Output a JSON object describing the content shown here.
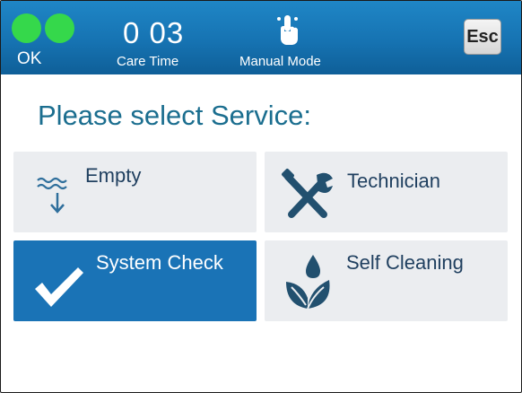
{
  "header": {
    "status_label": "OK",
    "care_time_value": "0 03",
    "care_time_label": "Care Time",
    "mode_label": "Manual Mode",
    "mode_icon": "hand-touch-icon",
    "esc_label": "Esc"
  },
  "prompt": "Please select Service:",
  "services": [
    {
      "label": "Empty",
      "icon": "drain-water-icon",
      "selected": false
    },
    {
      "label": "Technician",
      "icon": "tools-icon",
      "selected": false
    },
    {
      "label": "System Check",
      "icon": "checkmark-icon",
      "selected": true
    },
    {
      "label": "Self Cleaning",
      "icon": "leaf-drop-icon",
      "selected": false
    }
  ],
  "colors": {
    "header_blue": "#1673b2",
    "status_green": "#35d84b",
    "selected_tile": "#1a73b6",
    "tile_bg": "#ebedf0",
    "prompt_text": "#1b6e8f",
    "tile_text": "#1f3f5f"
  }
}
